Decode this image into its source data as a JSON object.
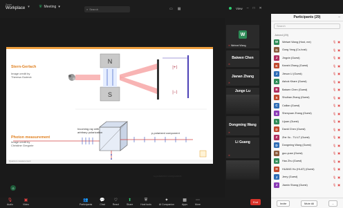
{
  "topbar": {
    "brand_small": "Zoom",
    "brand_big": "Workplace",
    "meeting_label": "Meeting",
    "search_placeholder": "Search",
    "view_label": "View"
  },
  "slide": {
    "stern_title": "Stern-Gerlach",
    "stern_credit_1": "Image credit by",
    "stern_credit_2": "Theresa Gudeck",
    "meas_title": "Photon measurement",
    "meas_credit_1": "Image credit by",
    "meas_credit_2": "Christine Gregorie",
    "split_label_1": "Incoming ray with",
    "split_label_2": "arbitrary polarization",
    "beam_top": "p-polarized component",
    "beam_bottom": "s-polarized component",
    "magnet_n": "N",
    "magnet_s": "S",
    "state_up": "|+⟩",
    "state_down": "|−⟩",
    "footer": "Quantum measurement"
  },
  "gallery": {
    "tiles": [
      {
        "name": "Weimei Wang",
        "initial": "W"
      },
      {
        "name": "Baiwen Chen"
      },
      {
        "name": "Jianan Zhang"
      },
      {
        "name": "Junge Lu"
      },
      {
        "name": "Dongming Wang"
      },
      {
        "name": "Li Guang"
      }
    ],
    "self_initial": "G"
  },
  "panel": {
    "title": "Participants (29)",
    "search_placeholder": "Search",
    "section_label": "Joined (29)",
    "participants": [
      {
        "name": "Weiwei Wang (Host, me)",
        "initial": "W",
        "color": "#2e8b57"
      },
      {
        "name": "Gong Yang (Co-host)",
        "initial": "G",
        "color": "#8a5a3b"
      },
      {
        "name": "Jingxin (Guest)",
        "initial": "J",
        "color": "#b03060"
      },
      {
        "name": "Kanshi Zhang (Guest)",
        "initial": "K",
        "color": "#c04a2e"
      },
      {
        "name": "Jiesun Li (Guest)",
        "initial": "J",
        "color": "#2f6db5"
      },
      {
        "name": "Ashok Khare (Guest)",
        "initial": "A",
        "color": "#2e8b57"
      },
      {
        "name": "Baiwen Chen (Guest)",
        "initial": "B",
        "color": "#b03060"
      },
      {
        "name": "Shuihan Zhang (Guest)",
        "initial": "S",
        "color": "#c04a2e"
      },
      {
        "name": "Cailian (Guest)",
        "initial": "C",
        "color": "#2f6db5"
      },
      {
        "name": "Shenyuan Zhang (Guest)",
        "initial": "S",
        "color": "#8a3bb5"
      },
      {
        "name": "Lijuan (Guest)",
        "initial": "L",
        "color": "#2e8b57"
      },
      {
        "name": "David Chen (Guest)",
        "initial": "D",
        "color": "#c04a2e"
      },
      {
        "name": "Zhe Xu - TU-LT (Guest)",
        "initial": "Z",
        "color": "#b03060"
      },
      {
        "name": "Dongming Wang (Guest)",
        "initial": "D",
        "color": "#2f6db5"
      },
      {
        "name": "guo-yuan (Guest)",
        "initial": "G",
        "color": "#8a5a3b"
      },
      {
        "name": "Hao Zhu (Guest)",
        "initial": "H",
        "color": "#2e8b57"
      },
      {
        "name": "HUANG Hu (HI-AT) (Guest)",
        "initial": "H",
        "color": "#c04a2e"
      },
      {
        "name": "Jerry (Guest)",
        "initial": "J",
        "color": "#2f6db5"
      },
      {
        "name": "Jiamin Shang (Guest)",
        "initial": "J",
        "color": "#8a3bb5"
      }
    ],
    "invite_label": "Invite",
    "mute_all_label": "Mute All",
    "more_label": "..."
  },
  "toolbar": {
    "items": [
      {
        "label": "Audio",
        "icon": "mic-icon"
      },
      {
        "label": "Video",
        "icon": "camera-icon"
      },
      {
        "label": "Participants",
        "icon": "people-icon"
      },
      {
        "label": "Chat",
        "icon": "chat-icon"
      },
      {
        "label": "React",
        "icon": "heart-icon"
      },
      {
        "label": "Share",
        "icon": "share-icon"
      },
      {
        "label": "Host tools",
        "icon": "shield-icon"
      },
      {
        "label": "AI Companion",
        "icon": "sparkle-icon"
      },
      {
        "label": "Apps",
        "icon": "apps-icon"
      },
      {
        "label": "More",
        "icon": "more-icon"
      }
    ],
    "end_label": "End"
  }
}
